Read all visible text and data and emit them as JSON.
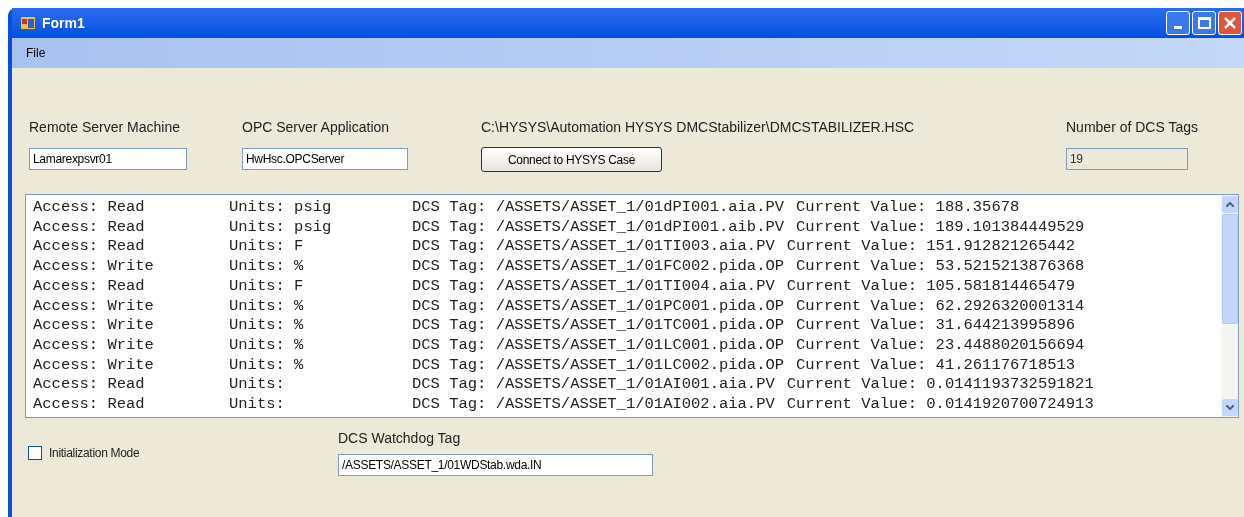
{
  "window": {
    "title": "Form1"
  },
  "menu": [
    "File"
  ],
  "remote_server": {
    "label": "Remote Server Machine",
    "value": "Lamarexpsvr01"
  },
  "opc_server": {
    "label": "OPC Server Application",
    "value": "HwHsc.OPCServer"
  },
  "case_path": {
    "label": "C:\\HYSYS\\Automation HYSYS DMCStabilizer\\DMCSTABILIZER.HSC",
    "button": "Connect to HYSYS Case"
  },
  "tag_count": {
    "label": "Number of DCS Tags",
    "value": "19",
    "disabled": true
  },
  "tag_list": [
    {
      "access": "Access: Read",
      "units": "Units: psig",
      "tag": "DCS Tag: /ASSETS/ASSET_1/01dPI001.aia.PV",
      "value": "Current Value: 188.35678"
    },
    {
      "access": "Access: Read",
      "units": "Units: psig",
      "tag": "DCS Tag: /ASSETS/ASSET_1/01dPI001.aib.PV",
      "value": "Current Value: 189.101384449529"
    },
    {
      "access": "Access: Read",
      "units": "Units: F",
      "tag": "DCS Tag: /ASSETS/ASSET_1/01TI003.aia.PV",
      "value": "Current Value: 151.912821265442"
    },
    {
      "access": "Access: Write",
      "units": "Units: %",
      "tag": "DCS Tag: /ASSETS/ASSET_1/01FC002.pida.OP",
      "value": "Current Value: 53.5215213876368"
    },
    {
      "access": "Access: Read",
      "units": "Units: F",
      "tag": "DCS Tag: /ASSETS/ASSET_1/01TI004.aia.PV",
      "value": "Current Value: 105.581814465479"
    },
    {
      "access": "Access: Write",
      "units": "Units: %",
      "tag": "DCS Tag: /ASSETS/ASSET_1/01PC001.pida.OP",
      "value": "Current Value: 62.2926320001314"
    },
    {
      "access": "Access: Write",
      "units": "Units: %",
      "tag": "DCS Tag: /ASSETS/ASSET_1/01TC001.pida.OP",
      "value": "Current Value: 31.644213995896"
    },
    {
      "access": "Access: Write",
      "units": "Units: %",
      "tag": "DCS Tag: /ASSETS/ASSET_1/01LC001.pida.OP",
      "value": "Current Value: 23.4488020156694"
    },
    {
      "access": "Access: Write",
      "units": "Units: %",
      "tag": "DCS Tag: /ASSETS/ASSET_1/01LC002.pida.OP",
      "value": "Current Value: 41.261176718513"
    },
    {
      "access": "Access: Read",
      "units": "Units:",
      "tag": "DCS Tag: /ASSETS/ASSET_1/01AI001.aia.PV",
      "value": "Current Value: 0.0141193732591821"
    },
    {
      "access": "Access: Read",
      "units": "Units:",
      "tag": "DCS Tag: /ASSETS/ASSET_1/01AI002.aia.PV",
      "value": "Current Value: 0.0141920700724913"
    }
  ],
  "initialization_mode": {
    "label": "Initialization Mode",
    "checked": false
  },
  "watchdog": {
    "label": "DCS Watchdog Tag",
    "value": "/ASSETS/ASSET_1/01WDStab.wda.IN"
  }
}
